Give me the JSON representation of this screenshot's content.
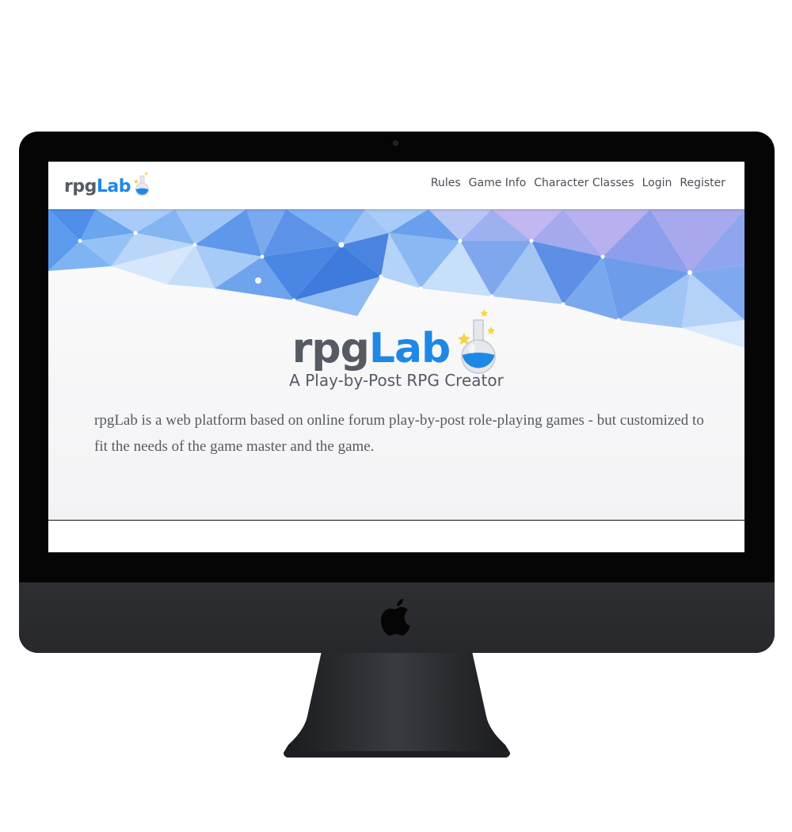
{
  "brand": {
    "part1": "rpg",
    "part2": "Lab"
  },
  "nav": {
    "links": [
      "Rules",
      "Game Info",
      "Character Classes",
      "Login",
      "Register"
    ]
  },
  "hero": {
    "logo_part1": "rpg",
    "logo_part2": "Lab",
    "subtitle": "A Play-by-Post RPG Creator",
    "description": "rpgLab is a web platform based on online forum play-by-post role-playing games - but customized to fit the needs of the game master and the game."
  },
  "colors": {
    "brand_gray": "#555a63",
    "brand_blue": "#1e88e5",
    "device": "#050506"
  },
  "icons": [
    "flask-icon",
    "star-icon",
    "apple-logo-icon"
  ]
}
